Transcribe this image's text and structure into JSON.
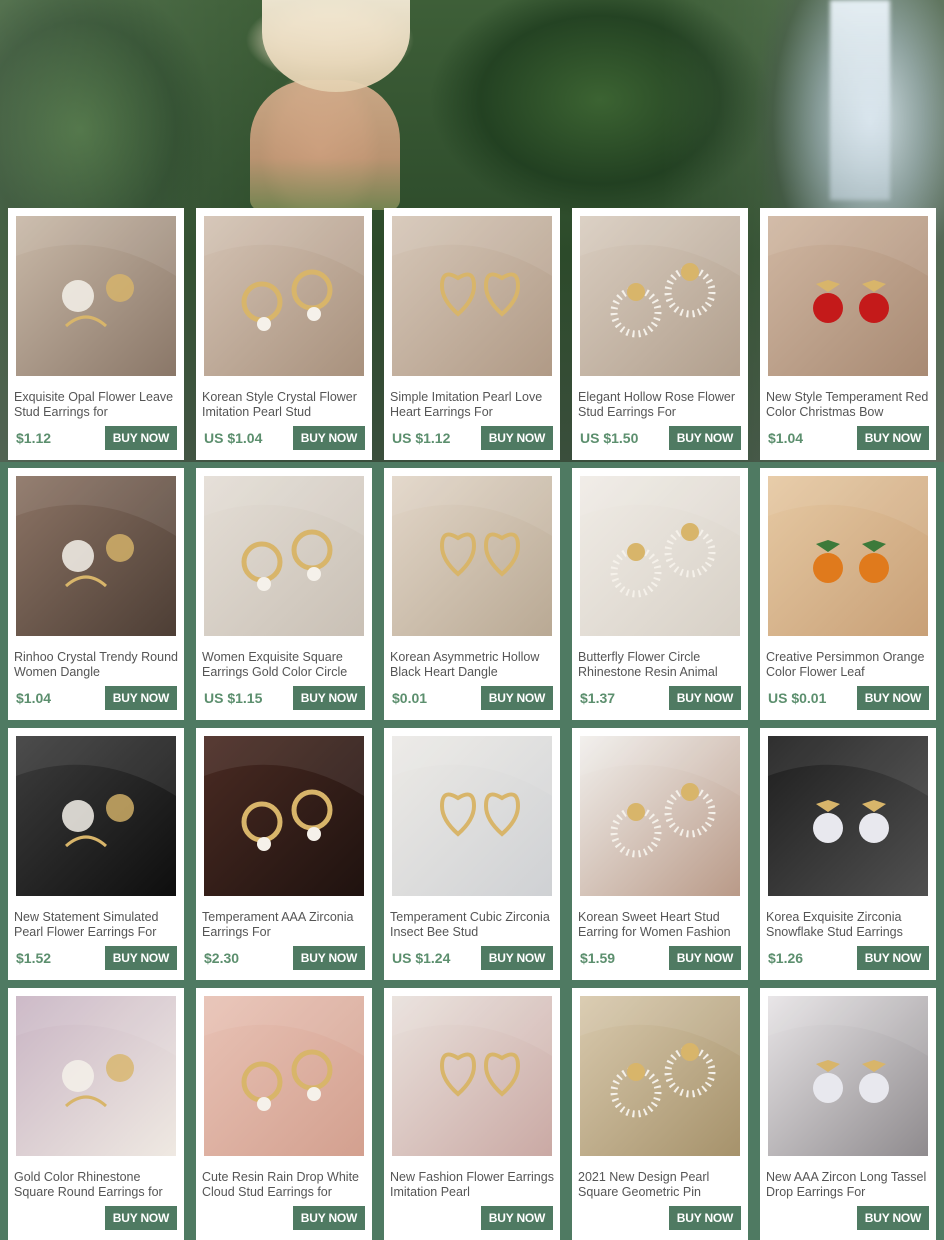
{
  "banner": {
    "image": "woman-in-sun-hat-by-waterfall"
  },
  "colors": {
    "accent": "#4f7a62",
    "price": "#5c8f6e",
    "card": "#ffffff",
    "title": "#555555"
  },
  "products": [
    {
      "title": "Exquisite Opal Flower Leave Stud Earrings for",
      "price": "$1.12",
      "buy_label": "BUY NOW",
      "icon": "opal-flower-earring-photo"
    },
    {
      "title": "Korean Style Crystal Flower Imitation Pearl Stud",
      "price": "US $1.04",
      "buy_label": "BUY NOW",
      "icon": "crystal-flower-pearl-earring-photo"
    },
    {
      "title": "Simple Imitation Pearl Love Heart Earrings For",
      "price": "US $1.12",
      "buy_label": "BUY NOW",
      "icon": "pearl-heart-earring-photo"
    },
    {
      "title": "Elegant Hollow Rose Flower Stud Earrings For",
      "price": "US $1.50",
      "buy_label": "BUY NOW",
      "icon": "rose-pearl-earring-photo"
    },
    {
      "title": "New Style Temperament Red Color Christmas Bow",
      "price": "$1.04",
      "buy_label": "BUY NOW",
      "icon": "red-bow-earring-photo"
    },
    {
      "title": "Rinhoo Crystal Trendy Round Women Dangle",
      "price": "$1.04",
      "buy_label": "BUY NOW",
      "icon": "bow-pearl-dangle-photo"
    },
    {
      "title": "Women Exquisite Square Earrings Gold Color Circle",
      "price": "US $1.15",
      "buy_label": "BUY NOW",
      "icon": "gold-square-earring-photo"
    },
    {
      "title": "Korean Asymmetric Hollow Black Heart Dangle",
      "price": "$0.01",
      "buy_label": "BUY NOW",
      "icon": "black-heart-dangle-photo"
    },
    {
      "title": "Butterfly Flower Circle Rhinestone Resin Animal",
      "price": "$1.37",
      "buy_label": "BUY NOW",
      "icon": "butterfly-flower-earring-photo"
    },
    {
      "title": "Creative Persimmon Orange Color Flower Leaf",
      "price": "US $0.01",
      "buy_label": "BUY NOW",
      "icon": "persimmon-earring-photo"
    },
    {
      "title": "New Statement Simulated Pearl Flower Earrings For",
      "price": "$1.52",
      "buy_label": "BUY NOW",
      "icon": "pearl-flower-earring-photo"
    },
    {
      "title": "Temperament AAA Zirconia Earrings For",
      "price": "$2.30",
      "buy_label": "BUY NOW",
      "icon": "zirconia-swirl-earring-photo"
    },
    {
      "title": "Temperament Cubic Zirconia Insect Bee Stud",
      "price": "US $1.24",
      "buy_label": "BUY NOW",
      "icon": "bee-stud-earring-photo"
    },
    {
      "title": "Korean Sweet Heart Stud Earring for Women Fashion",
      "price": "$1.59",
      "buy_label": "BUY NOW",
      "icon": "heart-ear-jacket-photo"
    },
    {
      "title": "Korea Exquisite Zirconia Snowflake Stud Earrings",
      "price": "$1.26",
      "buy_label": "BUY NOW",
      "icon": "snowflake-stud-earring-photo"
    },
    {
      "title": "Gold Color Rhinestone Square Round Earrings for",
      "price": "",
      "buy_label": "BUY NOW",
      "icon": "gold-rhinestone-square-photo"
    },
    {
      "title": "Cute Resin Rain Drop White Cloud Stud Earrings for",
      "price": "",
      "buy_label": "BUY NOW",
      "icon": "cloud-raindrop-earring-photo"
    },
    {
      "title": "New Fashion Flower Earrings Imitation Pearl",
      "price": "",
      "buy_label": "BUY NOW",
      "icon": "flower-stud-earring-photo"
    },
    {
      "title": "2021 New Design Pearl Square Geometric Pin",
      "price": "",
      "buy_label": "BUY NOW",
      "icon": "pearl-pin-earring-photo"
    },
    {
      "title": "New AAA Zircon Long Tassel Drop Earrings For",
      "price": "",
      "buy_label": "BUY NOW",
      "icon": "zircon-tassel-earring-photo"
    }
  ]
}
